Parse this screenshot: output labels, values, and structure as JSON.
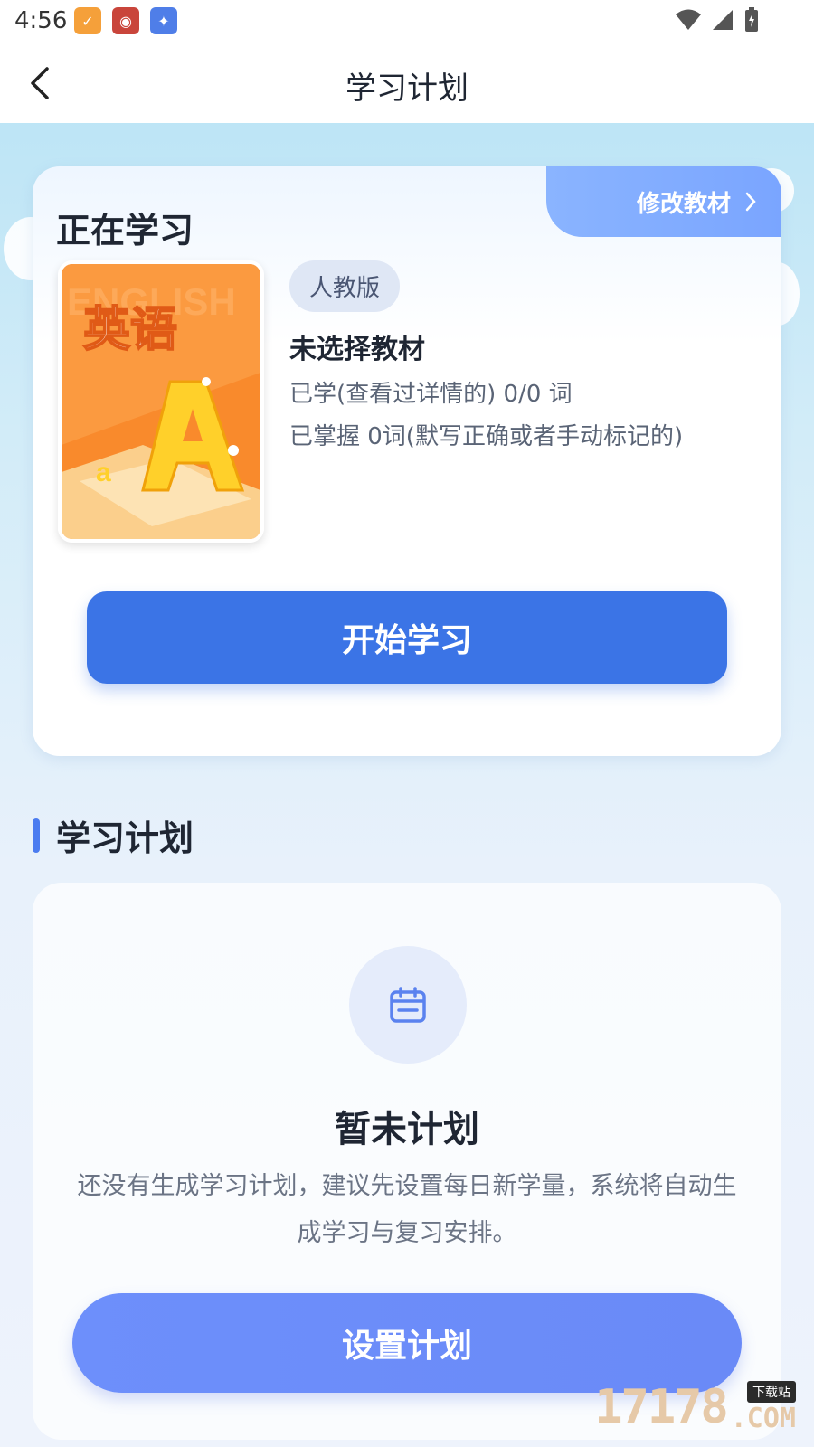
{
  "status_bar": {
    "time": "4:56"
  },
  "nav": {
    "title": "学习计划"
  },
  "current": {
    "section_label": "正在学习",
    "change_textbook": "修改教材",
    "cover_text": "英语",
    "cover_watermark": "ENGLISH",
    "edition": "人教版",
    "textbook_title": "未选择教材",
    "learned_stat": "已学(查看过详情的) 0/0 词",
    "mastered_stat": "已掌握 0词(默写正确或者手动标记的)",
    "start_button": "开始学习"
  },
  "plan": {
    "section_title": "学习计划",
    "empty_title": "暂未计划",
    "empty_desc": "还没有生成学习计划，建议先设置每日新学量，系统将自动生成学习与复习安排。",
    "set_button": "设置计划"
  },
  "watermark": {
    "number": "17178",
    "tag": "下载站",
    "domain": ".COM"
  },
  "colors": {
    "primary": "#3b74e6",
    "plan_button": "#6d8ffb",
    "tab": "#7aa5ff"
  }
}
